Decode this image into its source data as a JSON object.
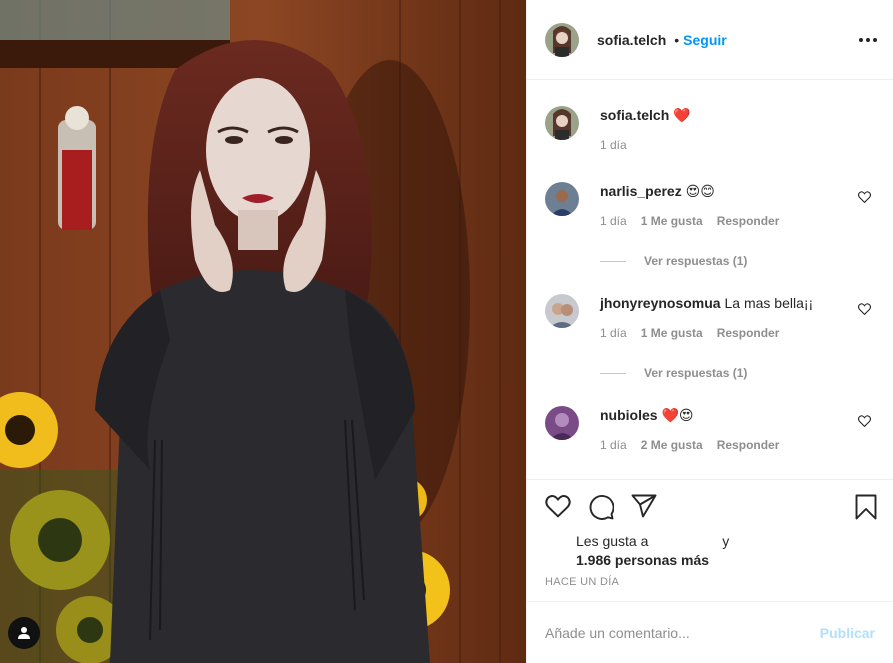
{
  "post": {
    "username": "sofia.telch",
    "follow_label": "Seguir",
    "dot": "•",
    "caption_emoji": "❤️",
    "caption_time": "1 día"
  },
  "comments": [
    {
      "user": "narlis_perez",
      "text": "😍😊",
      "time": "1 día",
      "likes": "1 Me gusta",
      "reply": "Responder",
      "view_replies": "Ver respuestas (1)"
    },
    {
      "user": "jhonyreynosomua",
      "text": "La mas bella¡¡",
      "time": "1 día",
      "likes": "1 Me gusta",
      "reply": "Responder",
      "view_replies": "Ver respuestas (1)"
    },
    {
      "user": "nubioles",
      "text": "❤️😍",
      "time": "1 día",
      "likes": "2 Me gusta",
      "reply": "Responder"
    }
  ],
  "likes_line1": "Les gusta a",
  "likes_line1_end": "y",
  "likes_count": "1.986 personas más",
  "time_ago": "HACE UN DÍA",
  "comment_placeholder": "Añade un comentario...",
  "publish_label": "Publicar",
  "icons": [
    "heart-icon",
    "comment-icon",
    "share-icon",
    "bookmark-icon",
    "more-options-icon",
    "user-tag-icon"
  ],
  "colors": {
    "link": "#0095f6",
    "publish_disabled": "#b2dffc",
    "muted": "#8e8e8e",
    "heart_red": "#ed4956"
  }
}
